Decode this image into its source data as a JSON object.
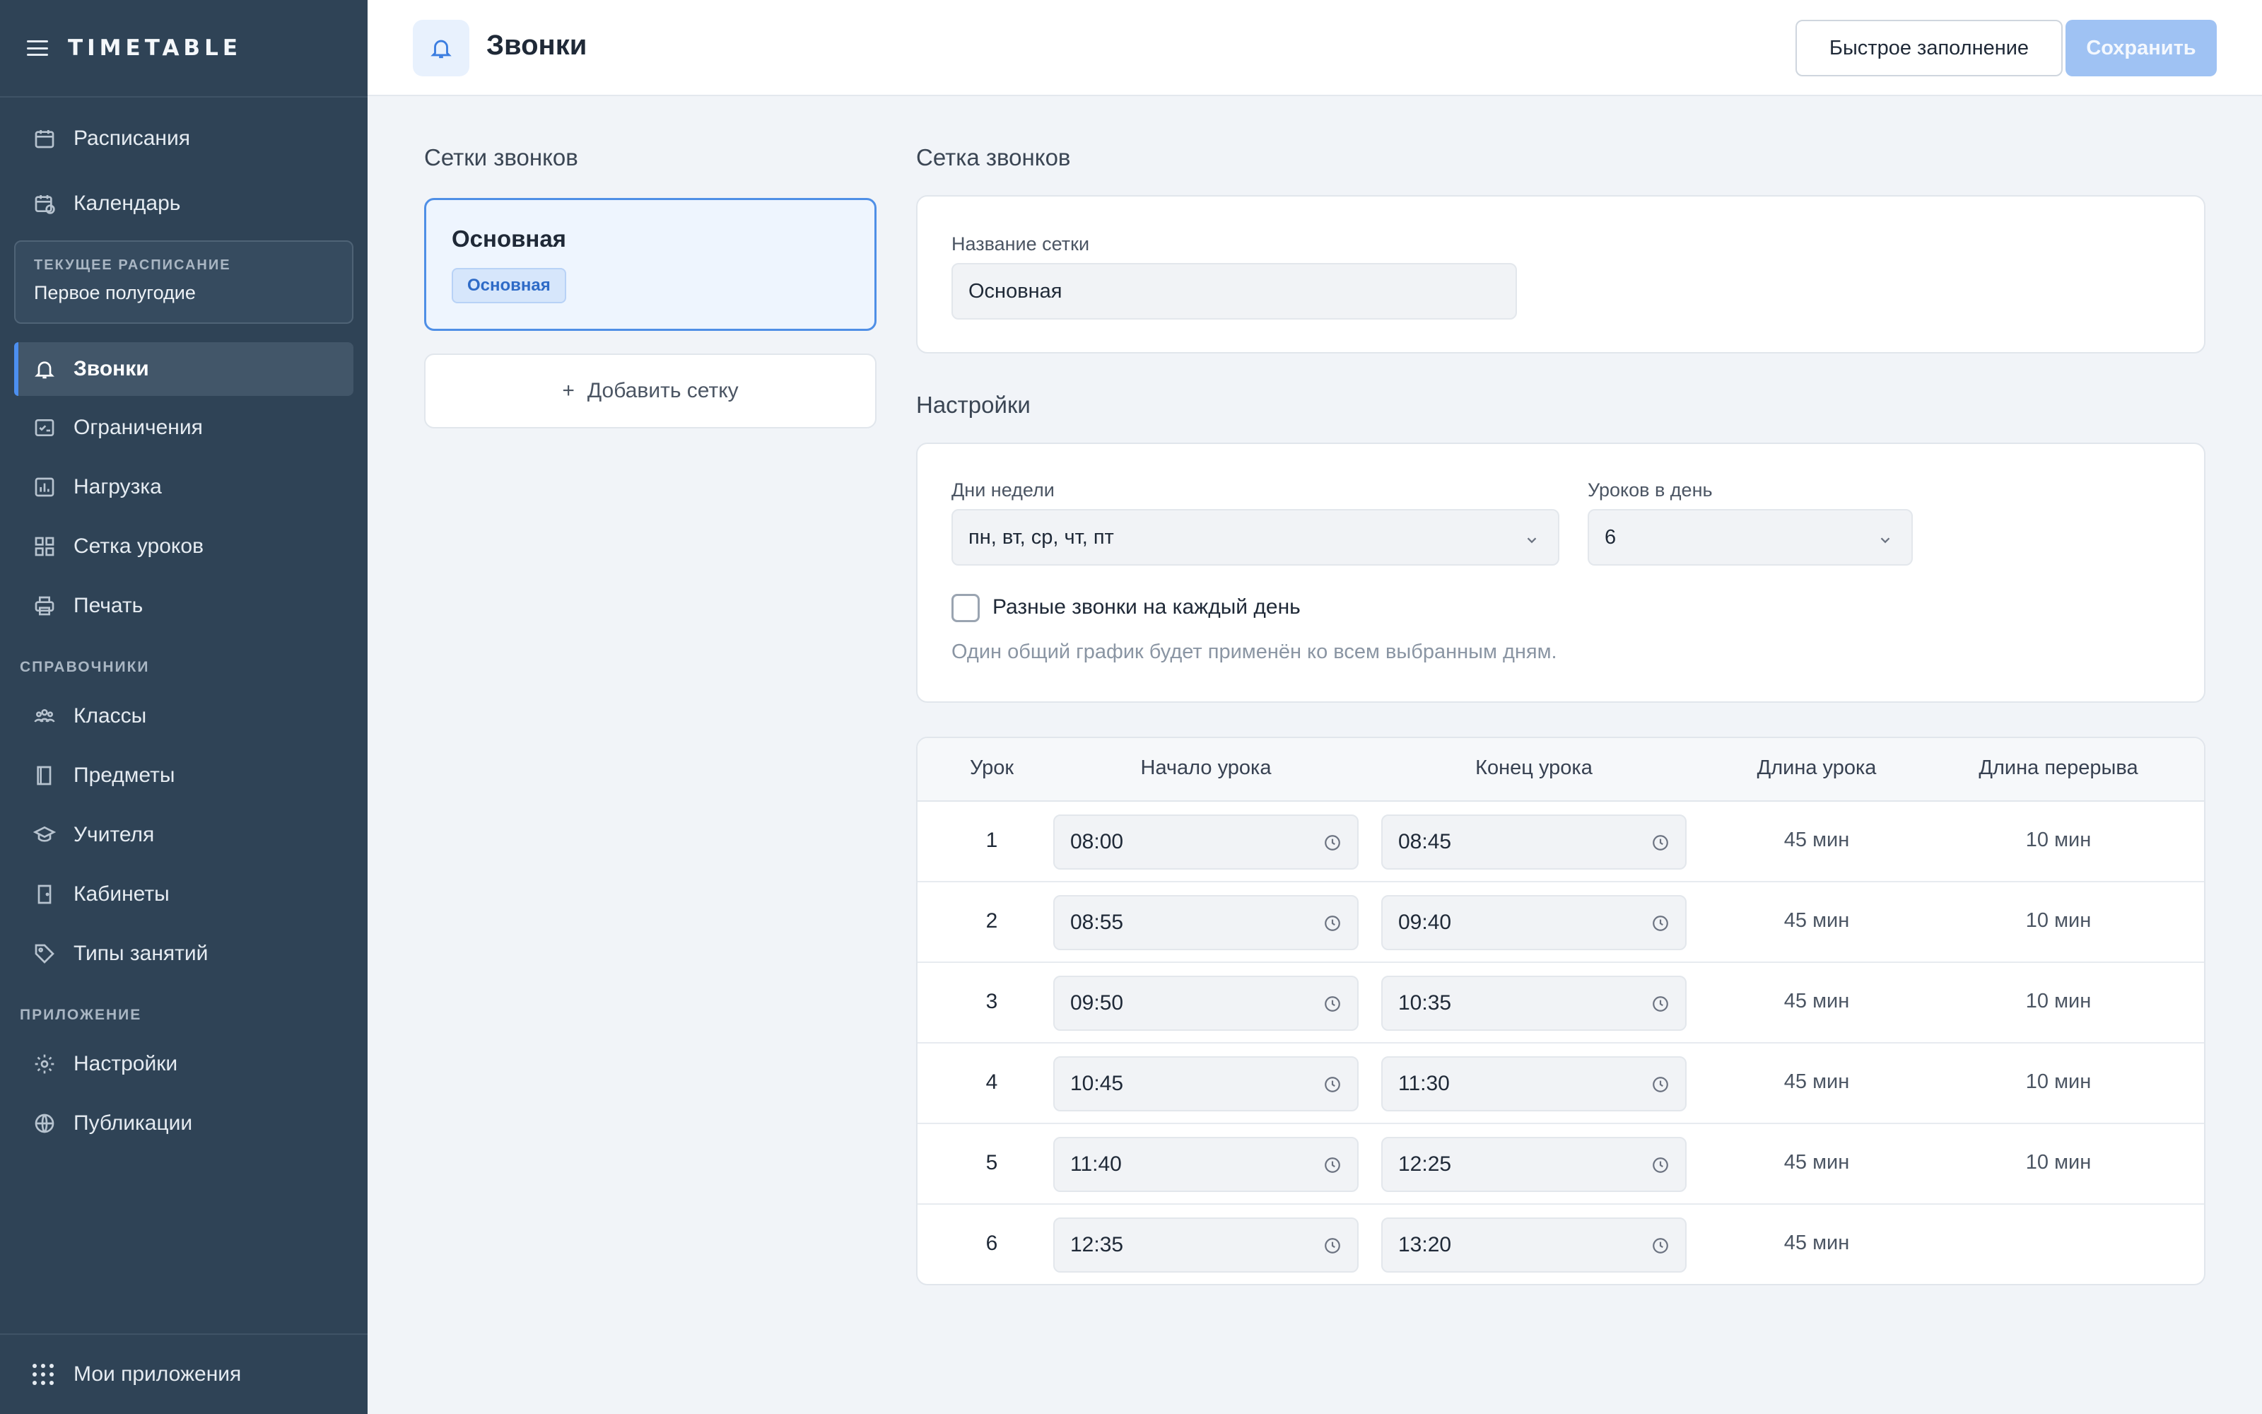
{
  "app": {
    "brand": "TIMETABLE"
  },
  "sidebar": {
    "top_items": [
      {
        "label": "Расписания",
        "icon": "calendar-icon"
      },
      {
        "label": "Календарь",
        "icon": "calendar-clock-icon"
      }
    ],
    "current_schedule": {
      "label": "ТЕКУЩЕЕ РАСПИСАНИЕ",
      "value": "Первое полугодие"
    },
    "schedule_items": [
      {
        "label": "Звонки",
        "icon": "bell-icon",
        "active": true
      },
      {
        "label": "Ограничения",
        "icon": "checklist-icon"
      },
      {
        "label": "Нагрузка",
        "icon": "bar-chart-icon"
      },
      {
        "label": "Сетка уроков",
        "icon": "grid-icon"
      },
      {
        "label": "Печать",
        "icon": "printer-icon"
      }
    ],
    "sections": {
      "references": "СПРАВОЧНИКИ",
      "app": "ПРИЛОЖЕНИЕ"
    },
    "reference_items": [
      {
        "label": "Классы",
        "icon": "users-icon"
      },
      {
        "label": "Предметы",
        "icon": "book-icon"
      },
      {
        "label": "Учителя",
        "icon": "graduation-cap-icon"
      },
      {
        "label": "Кабинеты",
        "icon": "door-icon"
      },
      {
        "label": "Типы занятий",
        "icon": "tag-icon"
      }
    ],
    "app_items": [
      {
        "label": "Настройки",
        "icon": "gear-icon"
      },
      {
        "label": "Публикации",
        "icon": "globe-icon"
      }
    ],
    "footer": {
      "label": "Мои приложения",
      "icon": "apps-grid-icon"
    }
  },
  "header": {
    "title": "Звонки",
    "icon": "bell-icon",
    "quick_fill_label": "Быстрое заполнение",
    "save_label": "Сохранить"
  },
  "grids": {
    "title": "Сетки звонков",
    "items": [
      {
        "name": "Основная",
        "badge": "Основная",
        "selected": true
      }
    ],
    "add_label": "Добавить сетку"
  },
  "grid_editor": {
    "title": "Сетка звонков",
    "name_label": "Название сетки",
    "name_value": "Основная"
  },
  "settings": {
    "title": "Настройки",
    "days_label": "Дни недели",
    "days_value": "пн, вт, ср, чт, пт",
    "lessons_label": "Уроков в день",
    "lessons_value": "6",
    "different_bells_label": "Разные звонки на каждый день",
    "different_bells_checked": false,
    "hint": "Один общий график будет применён ко всем выбранным дням."
  },
  "table": {
    "headers": [
      "Урок",
      "Начало урока",
      "Конец урока",
      "Длина урока",
      "Длина перерыва"
    ],
    "rows": [
      {
        "num": "1",
        "start": "08:00",
        "end": "08:45",
        "length": "45 мин",
        "break": "10 мин"
      },
      {
        "num": "2",
        "start": "08:55",
        "end": "09:40",
        "length": "45 мин",
        "break": "10 мин"
      },
      {
        "num": "3",
        "start": "09:50",
        "end": "10:35",
        "length": "45 мин",
        "break": "10 мин"
      },
      {
        "num": "4",
        "start": "10:45",
        "end": "11:30",
        "length": "45 мин",
        "break": "10 мин"
      },
      {
        "num": "5",
        "start": "11:40",
        "end": "12:25",
        "length": "45 мин",
        "break": "10 мин"
      },
      {
        "num": "6",
        "start": "12:35",
        "end": "13:20",
        "length": "45 мин",
        "break": ""
      }
    ]
  },
  "colors": {
    "accent": "#4c8ff0",
    "sidebar": "#2f4356",
    "save_button": "#9fc2f3"
  }
}
